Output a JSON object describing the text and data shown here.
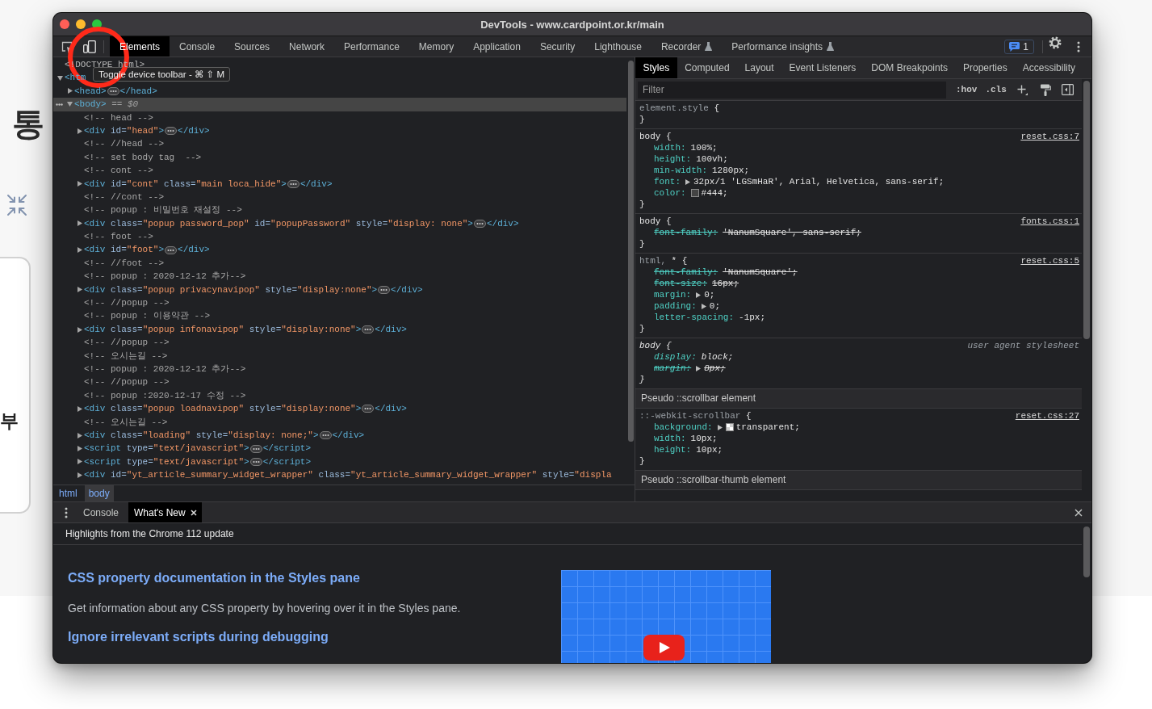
{
  "background_page": {
    "heading": "통",
    "side_label": "부"
  },
  "window": {
    "title": "DevTools - www.cardpoint.or.kr/main"
  },
  "toolbar": {
    "tabs": [
      {
        "label": "Elements",
        "selected": true,
        "experimental": false
      },
      {
        "label": "Console",
        "selected": false,
        "experimental": false
      },
      {
        "label": "Sources",
        "selected": false,
        "experimental": false
      },
      {
        "label": "Network",
        "selected": false,
        "experimental": false
      },
      {
        "label": "Performance",
        "selected": false,
        "experimental": false
      },
      {
        "label": "Memory",
        "selected": false,
        "experimental": false
      },
      {
        "label": "Application",
        "selected": false,
        "experimental": false
      },
      {
        "label": "Security",
        "selected": false,
        "experimental": false
      },
      {
        "label": "Lighthouse",
        "selected": false,
        "experimental": false
      },
      {
        "label": "Recorder",
        "selected": false,
        "experimental": true
      },
      {
        "label": "Performance insights",
        "selected": false,
        "experimental": true
      }
    ],
    "issues_count": "1"
  },
  "tooltip": {
    "text": "Toggle device toolbar - ⌘ ⇧ M"
  },
  "elements": {
    "tree": [
      {
        "kind": "doctype",
        "selected": false,
        "text": "<!DOCTYPE html>"
      },
      {
        "kind": "element",
        "selected": false,
        "expanded": true,
        "parts": [
          {
            "kind": "tag",
            "text": "<htm"
          }
        ],
        "children": [
          {
            "kind": "element",
            "selected": false,
            "expanded": false,
            "parts": [
              {
                "kind": "tag",
                "text": "<head>"
              }
            ],
            "end_tag": "</head>"
          },
          {
            "kind": "element",
            "selected": true,
            "expanded": true,
            "parts": [
              {
                "kind": "tag",
                "text": "<body>"
              },
              {
                "kind": "note",
                "text": " =="
              },
              {
                "kind": "variable",
                "text": " $0"
              }
            ],
            "children": [
              {
                "kind": "comment",
                "selected": false,
                "text": "<!-- head -->"
              },
              {
                "kind": "element",
                "selected": false,
                "expanded": false,
                "parts": [
                  {
                    "kind": "tag",
                    "text": "<div"
                  },
                  {
                    "kind": "attr",
                    "text": " id="
                  },
                  {
                    "kind": "value",
                    "text": "\"head\""
                  },
                  {
                    "kind": "tag",
                    "text": ">"
                  }
                ],
                "end_tag": "</div>"
              },
              {
                "kind": "comment",
                "selected": false,
                "text": "<!-- //head -->"
              },
              {
                "kind": "comment",
                "selected": false,
                "text": "<!-- set body tag  -->"
              },
              {
                "kind": "comment",
                "selected": false,
                "text": "<!-- cont -->"
              },
              {
                "kind": "element",
                "selected": false,
                "expanded": false,
                "parts": [
                  {
                    "kind": "tag",
                    "text": "<div"
                  },
                  {
                    "kind": "attr",
                    "text": " id="
                  },
                  {
                    "kind": "value",
                    "text": "\"cont\""
                  },
                  {
                    "kind": "attr",
                    "text": " class="
                  },
                  {
                    "kind": "value",
                    "text": "\"main loca_hide\""
                  },
                  {
                    "kind": "tag",
                    "text": ">"
                  }
                ],
                "end_tag": "</div>"
              },
              {
                "kind": "comment",
                "selected": false,
                "text": "<!-- //cont -->"
              },
              {
                "kind": "comment",
                "selected": false,
                "text": "<!-- popup : 비밀번호 재설정 -->"
              },
              {
                "kind": "element",
                "selected": false,
                "expanded": false,
                "parts": [
                  {
                    "kind": "tag",
                    "text": "<div"
                  },
                  {
                    "kind": "attr",
                    "text": " class="
                  },
                  {
                    "kind": "value",
                    "text": "\"popup password_pop\""
                  },
                  {
                    "kind": "attr",
                    "text": " id="
                  },
                  {
                    "kind": "value",
                    "text": "\"popupPassword\""
                  },
                  {
                    "kind": "attr",
                    "text": " style="
                  },
                  {
                    "kind": "value",
                    "text": "\"display: none\""
                  },
                  {
                    "kind": "tag",
                    "text": ">"
                  }
                ],
                "end_tag": "</div>"
              },
              {
                "kind": "comment",
                "selected": false,
                "text": "<!-- foot -->"
              },
              {
                "kind": "element",
                "selected": false,
                "expanded": false,
                "parts": [
                  {
                    "kind": "tag",
                    "text": "<div"
                  },
                  {
                    "kind": "attr",
                    "text": " id="
                  },
                  {
                    "kind": "value",
                    "text": "\"foot\""
                  },
                  {
                    "kind": "tag",
                    "text": ">"
                  }
                ],
                "end_tag": "</div>"
              },
              {
                "kind": "comment",
                "selected": false,
                "text": "<!-- //foot -->"
              },
              {
                "kind": "comment",
                "selected": false,
                "text": "<!-- popup : 2020-12-12 추가-->"
              },
              {
                "kind": "element",
                "selected": false,
                "expanded": false,
                "parts": [
                  {
                    "kind": "tag",
                    "text": "<div"
                  },
                  {
                    "kind": "attr",
                    "text": " class="
                  },
                  {
                    "kind": "value",
                    "text": "\"popup privacynavipop\""
                  },
                  {
                    "kind": "attr",
                    "text": " style="
                  },
                  {
                    "kind": "value",
                    "text": "\"display:none\""
                  },
                  {
                    "kind": "tag",
                    "text": ">"
                  }
                ],
                "end_tag": "</div>"
              },
              {
                "kind": "comment",
                "selected": false,
                "text": "<!-- //popup -->"
              },
              {
                "kind": "comment",
                "selected": false,
                "text": "<!-- popup : 이용약관 -->"
              },
              {
                "kind": "element",
                "selected": false,
                "expanded": false,
                "parts": [
                  {
                    "kind": "tag",
                    "text": "<div"
                  },
                  {
                    "kind": "attr",
                    "text": " class="
                  },
                  {
                    "kind": "value",
                    "text": "\"popup infonavipop\""
                  },
                  {
                    "kind": "attr",
                    "text": " style="
                  },
                  {
                    "kind": "value",
                    "text": "\"display:none\""
                  },
                  {
                    "kind": "tag",
                    "text": ">"
                  }
                ],
                "end_tag": "</div>"
              },
              {
                "kind": "comment",
                "selected": false,
                "text": "<!-- //popup -->"
              },
              {
                "kind": "comment",
                "selected": false,
                "text": "<!-- 오시는길 -->"
              },
              {
                "kind": "comment",
                "selected": false,
                "text": "<!-- popup : 2020-12-12 추가-->"
              },
              {
                "kind": "comment",
                "selected": false,
                "text": "<!-- //popup -->"
              },
              {
                "kind": "comment",
                "selected": false,
                "text": "<!-- popup :2020-12-17 수정 -->"
              },
              {
                "kind": "element",
                "selected": false,
                "expanded": false,
                "parts": [
                  {
                    "kind": "tag",
                    "text": "<div"
                  },
                  {
                    "kind": "attr",
                    "text": " class="
                  },
                  {
                    "kind": "value",
                    "text": "\"popup loadnavipop\""
                  },
                  {
                    "kind": "attr",
                    "text": " style="
                  },
                  {
                    "kind": "value",
                    "text": "\"display:none\""
                  },
                  {
                    "kind": "tag",
                    "text": ">"
                  }
                ],
                "end_tag": "</div>"
              },
              {
                "kind": "comment",
                "selected": false,
                "text": "<!-- 오시는길 -->"
              },
              {
                "kind": "element",
                "selected": false,
                "expanded": false,
                "parts": [
                  {
                    "kind": "tag",
                    "text": "<div"
                  },
                  {
                    "kind": "attr",
                    "text": " class="
                  },
                  {
                    "kind": "value",
                    "text": "\"loading\""
                  },
                  {
                    "kind": "attr",
                    "text": " style="
                  },
                  {
                    "kind": "value",
                    "text": "\"display: none;\""
                  },
                  {
                    "kind": "tag",
                    "text": ">"
                  }
                ],
                "end_tag": "</div>"
              },
              {
                "kind": "element",
                "selected": false,
                "expanded": false,
                "parts": [
                  {
                    "kind": "tag",
                    "text": "<script"
                  },
                  {
                    "kind": "attr",
                    "text": " type="
                  },
                  {
                    "kind": "value",
                    "text": "\"text/javascript\""
                  },
                  {
                    "kind": "tag",
                    "text": ">"
                  }
                ],
                "end_tag": "</script>"
              },
              {
                "kind": "element",
                "selected": false,
                "expanded": false,
                "parts": [
                  {
                    "kind": "tag",
                    "text": "<script"
                  },
                  {
                    "kind": "attr",
                    "text": " type="
                  },
                  {
                    "kind": "value",
                    "text": "\"text/javascript\""
                  },
                  {
                    "kind": "tag",
                    "text": ">"
                  }
                ],
                "end_tag": "</script>"
              },
              {
                "kind": "element",
                "selected": false,
                "expanded": false,
                "parts": [
                  {
                    "kind": "tag",
                    "text": "<div"
                  },
                  {
                    "kind": "attr",
                    "text": " id="
                  },
                  {
                    "kind": "value",
                    "text": "\"yt_article_summary_widget_wrapper\""
                  },
                  {
                    "kind": "attr",
                    "text": " class="
                  },
                  {
                    "kind": "value",
                    "text": "\"yt_article_summary_widget_wrapper\""
                  },
                  {
                    "kind": "attr",
                    "text": " style="
                  },
                  {
                    "kind": "value",
                    "text": "\"displa"
                  }
                ]
              }
            ]
          }
        ]
      }
    ],
    "breadcrumbs": [
      {
        "label": "html",
        "selected": false
      },
      {
        "label": "body",
        "selected": true
      }
    ]
  },
  "sidebar": {
    "tabs": [
      {
        "label": "Styles",
        "selected": true
      },
      {
        "label": "Computed",
        "selected": false
      },
      {
        "label": "Layout",
        "selected": false
      },
      {
        "label": "Event Listeners",
        "selected": false
      },
      {
        "label": "DOM Breakpoints",
        "selected": false
      },
      {
        "label": "Properties",
        "selected": false
      },
      {
        "label": "Accessibility",
        "selected": false
      }
    ],
    "filter": {
      "placeholder": "Filter"
    },
    "filter_buttons": [
      ":hov",
      ".cls"
    ],
    "rules": [
      {
        "kind": "rule",
        "user_agent": false,
        "selector": [
          {
            "text": "element.style",
            "matched": false
          }
        ],
        "open": "{",
        "close": "}"
      },
      {
        "kind": "rule",
        "user_agent": false,
        "selector": [
          {
            "text": "body",
            "matched": true
          }
        ],
        "open": "{",
        "close": "}",
        "source": "reset.css:7",
        "properties": [
          {
            "name": "width:",
            "value": "100%;",
            "overridden": false,
            "expandable": false
          },
          {
            "name": "height:",
            "value": "100vh;",
            "overridden": false,
            "expandable": false
          },
          {
            "name": "min-width:",
            "value": "1280px;",
            "overridden": false,
            "expandable": false
          },
          {
            "name": "font:",
            "value": "32px/1 'LGSmHaR', Arial, Helvetica, sans-serif;",
            "overridden": false,
            "expandable": true
          },
          {
            "name": "color:",
            "value": "#444;",
            "overridden": false,
            "expandable": false,
            "swatch": {
              "kind": "color",
              "color": "#444444"
            }
          }
        ]
      },
      {
        "kind": "rule",
        "user_agent": false,
        "selector": [
          {
            "text": "body",
            "matched": true
          }
        ],
        "open": "{",
        "close": "}",
        "source": "fonts.css:1",
        "properties": [
          {
            "name": "font-family:",
            "value": "'NanumSquare', sans-serif;",
            "overridden": true,
            "expandable": false
          }
        ]
      },
      {
        "kind": "rule",
        "user_agent": false,
        "selector": [
          {
            "text": "html,",
            "matched": false
          },
          {
            "text": "*",
            "matched": true
          }
        ],
        "open": "{",
        "close": "}",
        "source": "reset.css:5",
        "properties": [
          {
            "name": "font-family:",
            "value": "'NanumSquare';",
            "overridden": true,
            "expandable": false
          },
          {
            "name": "font-size:",
            "value": "16px;",
            "overridden": true,
            "expandable": false
          },
          {
            "name": "margin:",
            "value": "0;",
            "overridden": false,
            "expandable": true
          },
          {
            "name": "padding:",
            "value": "0;",
            "overridden": false,
            "expandable": true
          },
          {
            "name": "letter-spacing:",
            "value": "-1px;",
            "overridden": false,
            "expandable": false
          }
        ]
      },
      {
        "kind": "rule",
        "user_agent": true,
        "selector": [
          {
            "text": "body",
            "matched": true
          }
        ],
        "open": "{",
        "close": "}",
        "source": "user agent stylesheet",
        "properties": [
          {
            "name": "display:",
            "value": "block;",
            "overridden": false,
            "expandable": false
          },
          {
            "name": "margin:",
            "value": "8px;",
            "overridden": true,
            "expandable": true
          }
        ]
      },
      {
        "kind": "section",
        "text": "Pseudo ::scrollbar element"
      },
      {
        "kind": "rule",
        "user_agent": false,
        "selector": [
          {
            "text": "::-webkit-scrollbar",
            "matched": false
          }
        ],
        "open": "{",
        "close": "}",
        "source": "reset.css:27",
        "properties": [
          {
            "name": "background:",
            "value": "transparent;",
            "overridden": false,
            "expandable": true,
            "swatch": {
              "kind": "transparent"
            }
          },
          {
            "name": "width:",
            "value": "10px;",
            "overridden": false,
            "expandable": false
          },
          {
            "name": "height:",
            "value": "10px;",
            "overridden": false,
            "expandable": false
          }
        ]
      },
      {
        "kind": "section",
        "text": "Pseudo ::scrollbar-thumb element"
      }
    ]
  },
  "drawer": {
    "tabs": [
      {
        "label": "Console",
        "selected": false,
        "closable": false
      },
      {
        "label": "What's New",
        "selected": true,
        "closable": true
      }
    ],
    "header": "Highlights from the Chrome 112 update",
    "items": [
      {
        "kind": "heading",
        "text": "CSS property documentation in the Styles pane"
      },
      {
        "kind": "paragraph",
        "text": "Get information about any CSS property by hovering over it in the Styles pane."
      },
      {
        "kind": "heading",
        "text": "Ignore irrelevant scripts during debugging"
      }
    ]
  }
}
